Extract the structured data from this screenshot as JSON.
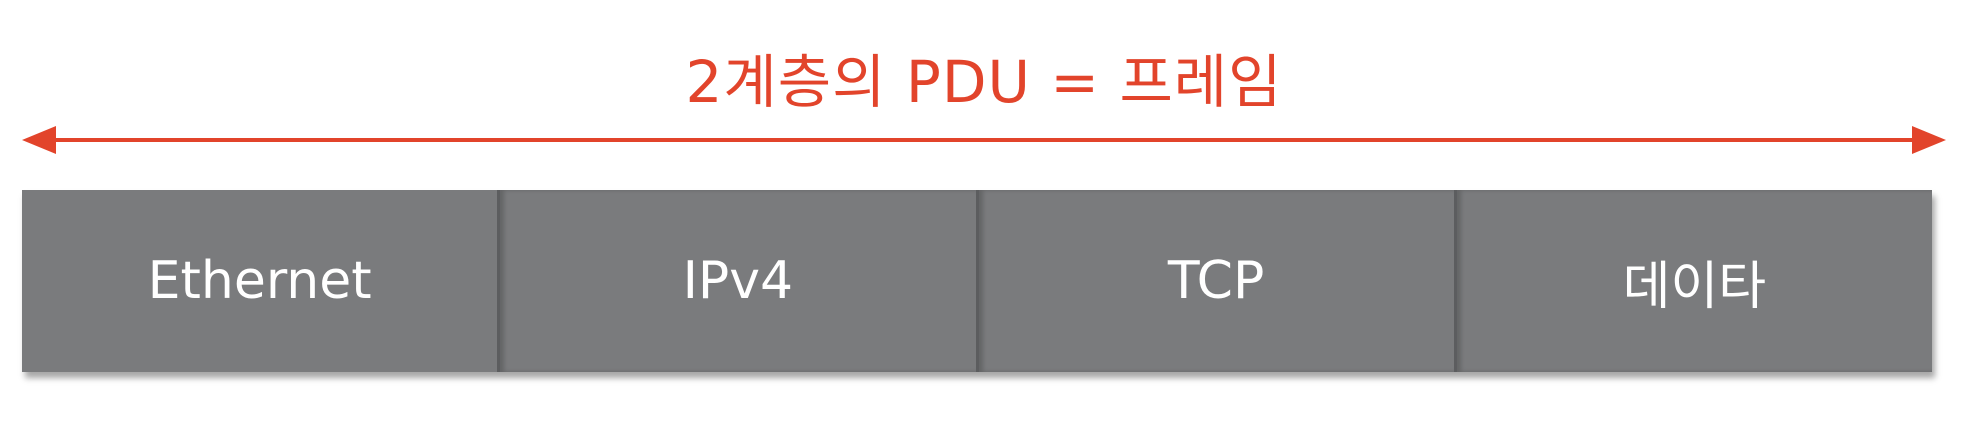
{
  "title": "2계층의 PDU = 프레임",
  "colors": {
    "accent": "#e2442b",
    "segment_fill": "#7a7b7d",
    "segment_text": "#ffffff"
  },
  "segments": [
    {
      "label": "Ethernet"
    },
    {
      "label": "IPv4"
    },
    {
      "label": "TCP"
    },
    {
      "label": "데이타"
    }
  ]
}
